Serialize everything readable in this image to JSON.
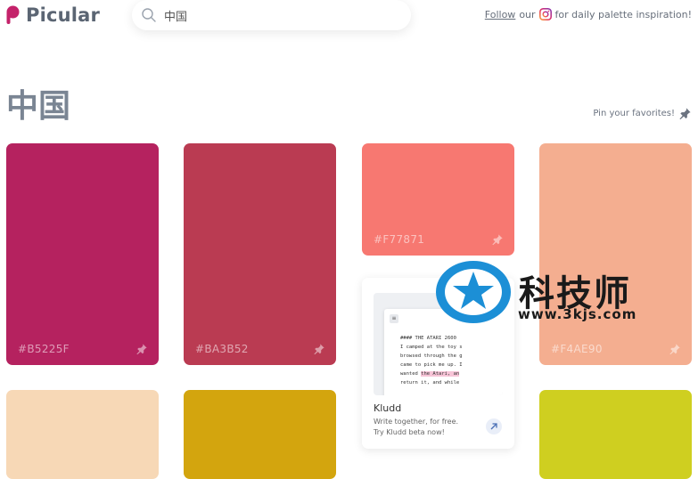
{
  "header": {
    "logo_text": "Picular",
    "search": {
      "value": "中国",
      "placeholder": ""
    },
    "follow": {
      "link": "Follow",
      "our": "our",
      "suffix": "for daily palette inspiration!"
    }
  },
  "page": {
    "title": "中国",
    "pin_hint": "Pin your favorites!"
  },
  "swatches": [
    {
      "hex": "#B5225F",
      "color": "#b5225f"
    },
    {
      "hex": "#BA3B52",
      "color": "#ba3b52"
    },
    {
      "hex": "#F77871",
      "color": "#f77871"
    },
    {
      "hex": "#F4AE90",
      "color": "#f4ae90"
    },
    {
      "hex": "",
      "color": "#f7d8b6"
    },
    {
      "hex": "",
      "color": "#d3a50e"
    },
    {
      "hex": "",
      "color": "#cfcf20"
    }
  ],
  "ad": {
    "preview_lines": [
      "#### THE ATARI 2600",
      "I camped at the toy s",
      "browsed through the g",
      "came to pick me up. I",
      "wanted ",
      "return it, and while"
    ],
    "preview_highlight": "the Atari, an",
    "title": "Kludd",
    "line1": "Write together, for free.",
    "line2": "Try Kludd beta now!"
  },
  "watermark": {
    "text": "科技师",
    "url": "www.3kjs.com"
  },
  "colors": {
    "accent": "#c4226a",
    "brand_text": "#5b6573",
    "title": "#7a8593"
  }
}
